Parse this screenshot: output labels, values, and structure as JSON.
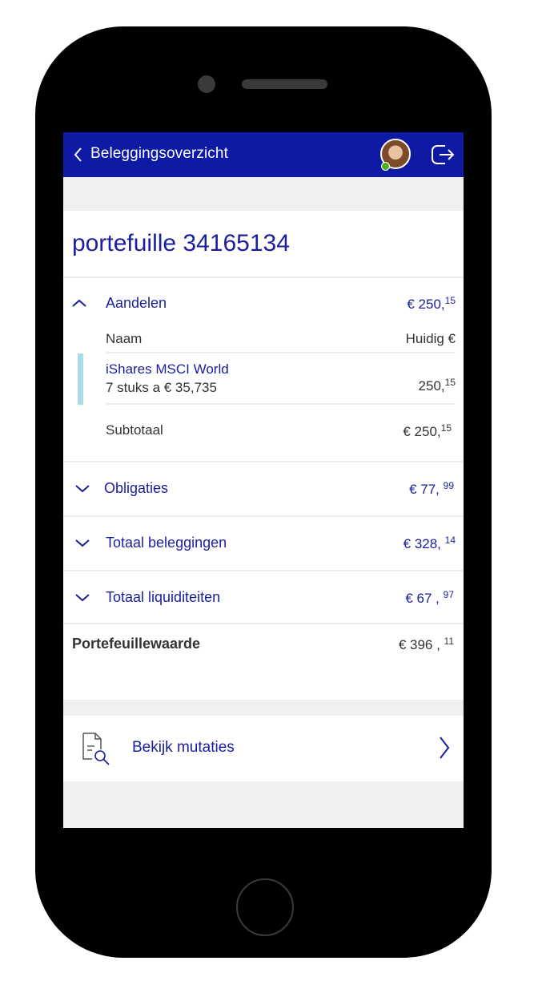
{
  "header": {
    "title": "Beleggingsoverzicht"
  },
  "portfolio": {
    "title": "portefuille 34165134"
  },
  "sections": {
    "aandelen": {
      "label": "Aandelen",
      "amount_main": "€ 250,",
      "amount_cents": "15",
      "columns": {
        "name": "Naam",
        "value": "Huidig €"
      },
      "holding": {
        "name": "iShares MSCI World",
        "detail": "7 stuks a € 35,735",
        "value_main": "250,",
        "value_cents": "15"
      },
      "subtotal": {
        "label": "Subtotaal",
        "amount_main": "€ 250,",
        "amount_cents": "15"
      }
    },
    "obligaties": {
      "label": "Obligaties",
      "amount_main": "€ 77, ",
      "amount_cents": "99"
    },
    "totaal_beleggingen": {
      "label": "Totaal beleggingen",
      "amount_main": "€ 328, ",
      "amount_cents": "14"
    },
    "totaal_liquiditeiten": {
      "label": "Totaal liquiditeiten",
      "amount_main": "€ 67 , ",
      "amount_cents": "97"
    }
  },
  "portefeuillewaarde": {
    "label": "Portefeuillewaarde",
    "amount_main": "€ 396 , ",
    "amount_cents": "11"
  },
  "mutaties": {
    "label": "Bekijk mutaties"
  },
  "icons": {
    "back": "chevron-left-icon",
    "logout": "logout-icon",
    "section_expanded": "chevron-up-icon",
    "section_collapsed": "chevron-down-icon",
    "mutaties": "document-search-icon",
    "mutaties_arrow": "chevron-right-icon"
  },
  "colors": {
    "brand": "#0e1aa3",
    "link": "#1a1f9c",
    "holding_marker": "#a9dbe8",
    "online": "#4caf1e",
    "background": "#eef0ef"
  }
}
